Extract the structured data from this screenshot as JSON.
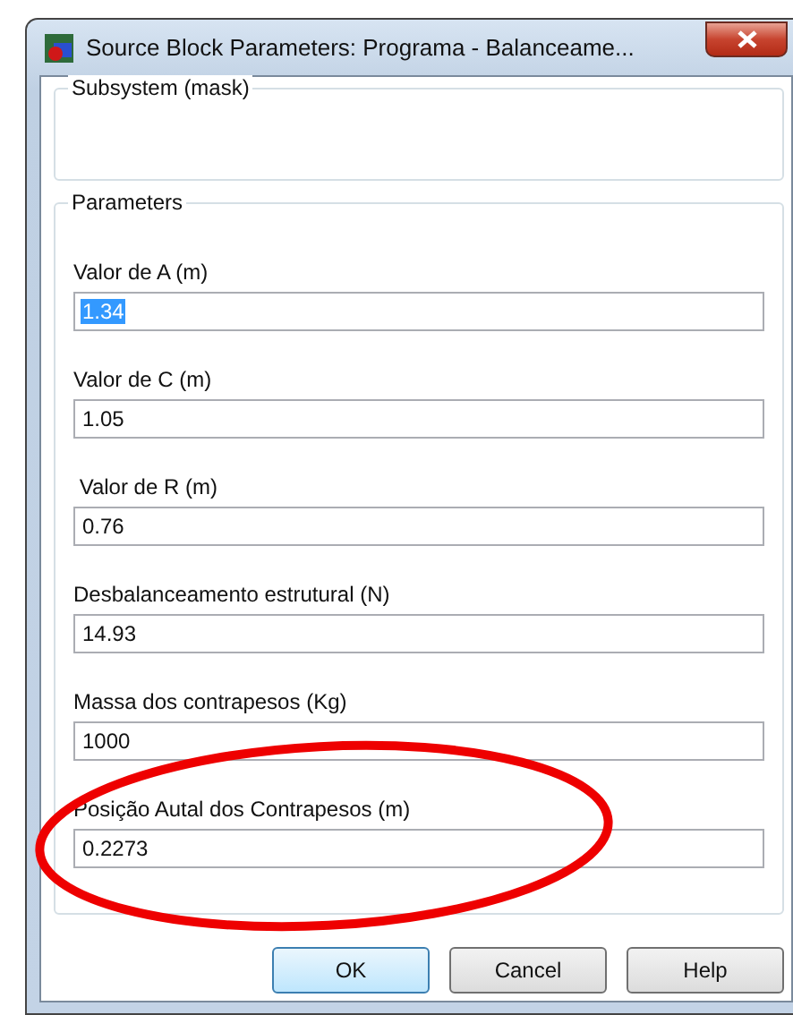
{
  "window": {
    "title": "Source Block Parameters: Programa - Balanceame..."
  },
  "subsystem": {
    "title": "Subsystem (mask)"
  },
  "parameters": {
    "title": "Parameters",
    "fields": [
      {
        "label": "Valor de A (m)",
        "value": "1.34",
        "highlighted": true
      },
      {
        "label": "Valor de C (m)",
        "value": "1.05",
        "highlighted": false
      },
      {
        "label": " Valor de R (m)",
        "value": "0.76",
        "highlighted": false
      },
      {
        "label": "Desbalanceamento estrutural (N)",
        "value": "14.93",
        "highlighted": false
      },
      {
        "label": "Massa dos contrapesos (Kg)",
        "value": "1000",
        "highlighted": false
      },
      {
        "label": "Posição Autal dos Contrapesos (m)",
        "value": "0.2273",
        "highlighted": false
      }
    ]
  },
  "buttons": [
    {
      "label": "OK",
      "default": true
    },
    {
      "label": "Cancel",
      "default": false
    },
    {
      "label": "Help",
      "default": false
    }
  ]
}
